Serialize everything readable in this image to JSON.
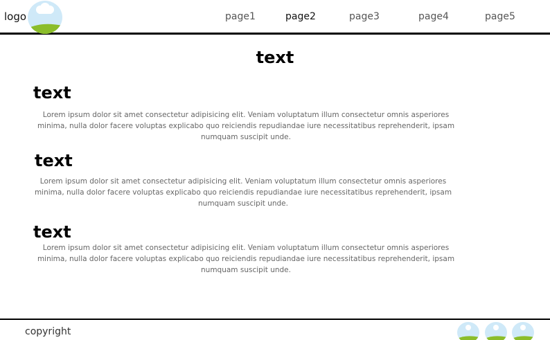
{
  "header": {
    "logo_label": "logo",
    "nav": [
      "page1",
      "page2",
      "page3",
      "page4",
      "page5"
    ]
  },
  "main": {
    "title": "text",
    "sections": [
      {
        "heading": "text",
        "body": "Lorem ipsum dolor sit amet consectetur adipisicing elit. Veniam voluptatum illum consectetur omnis asperiores minima, nulla dolor facere voluptas explicabo quo reiciendis repudiandae iure necessitatibus reprehenderit, ipsam numquam suscipit unde."
      },
      {
        "heading": "text",
        "body": "Lorem ipsum dolor sit amet consectetur adipisicing elit. Veniam voluptatum illum consectetur omnis asperiores minima, nulla dolor facere voluptas explicabo quo reiciendis repudiandae iure necessitatibus reprehenderit, ipsam numquam suscipit unde."
      },
      {
        "heading": "text",
        "body": "Lorem ipsum dolor sit amet consectetur adipisicing elit. Veniam voluptatum illum consectetur omnis asperiores minima, nulla dolor facere voluptas explicabo quo reiciendis repudiandae iure necessitatibus reprehenderit, ipsam numquam suscipit unde."
      }
    ]
  },
  "footer": {
    "copyright": "copyright",
    "social_icons": [
      "landscape-image-icon",
      "landscape-image-icon",
      "landscape-image-icon"
    ]
  },
  "colors": {
    "sky": "#cfe9f8",
    "grass": "#8bbd2a",
    "divider": "#000000"
  }
}
